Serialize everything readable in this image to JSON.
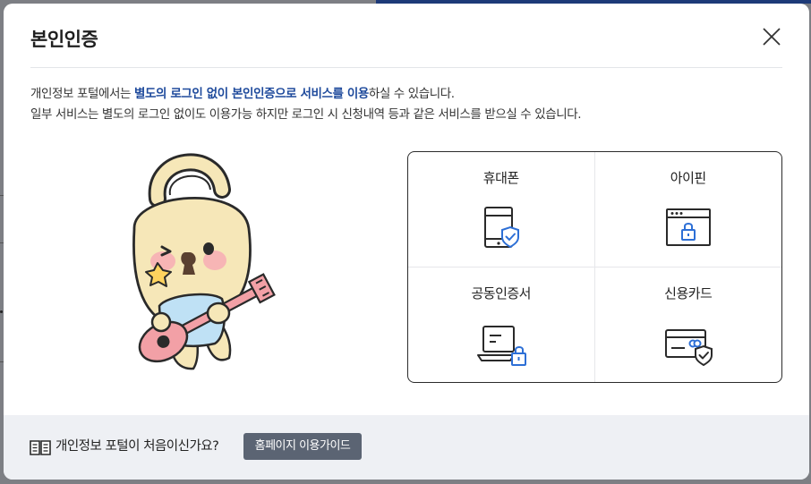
{
  "modal": {
    "title": "본인인증",
    "close_icon": "close-icon"
  },
  "intro": {
    "line1_prefix": "개인정보 포털에서는 ",
    "line1_highlight": "별도의 로그인 없이 본인인증으로 서비스를 이용",
    "line1_suffix": "하실 수 있습니다.",
    "line2": "일부 서비스는 별도의 로그인 없이도 이용가능 하지만 로그인 시 신청내역 등과 같은 서비스를 받으실 수 있습니다."
  },
  "auth_options": [
    {
      "label": "휴대폰",
      "icon": "phone-shield-icon"
    },
    {
      "label": "아이핀",
      "icon": "browser-lock-icon"
    },
    {
      "label": "공동인증서",
      "icon": "laptop-lock-icon"
    },
    {
      "label": "신용카드",
      "icon": "card-shield-icon"
    }
  ],
  "footer": {
    "icon": "book-icon",
    "text": "개인정보 포털이 처음이신가요?",
    "guide_button": "홈페이지 이용가이드"
  },
  "colors": {
    "accent_blue": "#1e4a9c",
    "icon_blue": "#2d6fd6",
    "footer_bg": "#eef0f4",
    "button_bg": "#5b6473"
  }
}
